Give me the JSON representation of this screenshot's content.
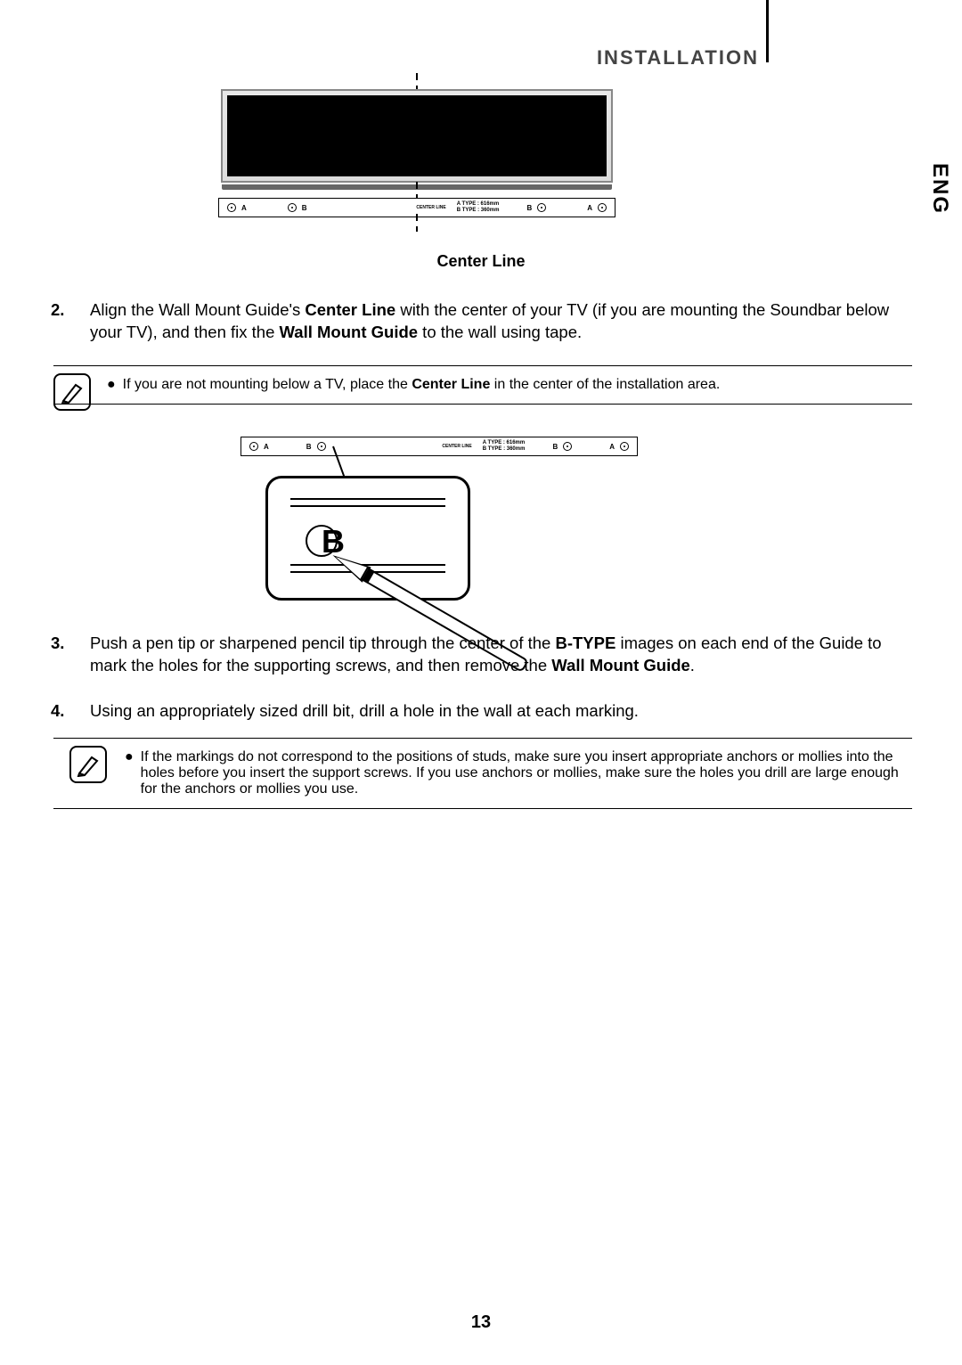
{
  "header": {
    "section_title": "INSTALLATION",
    "lang_tab": "ENG"
  },
  "fig1": {
    "label_A": "A",
    "label_B": "B",
    "label_center": "CENTER LINE",
    "type_a": "A TYPE : 616mm",
    "type_b": "B TYPE : 360mm",
    "caption": "Center Line"
  },
  "steps": {
    "s2_num": "2.",
    "s2_a": "Align the Wall Mount Guide's ",
    "s2_b": "Center Line",
    "s2_c": " with the center of your TV (if you are mounting the Soundbar below your TV), and then fix the ",
    "s2_d": "Wall Mount Guide",
    "s2_e": " to the wall using tape.",
    "s3_num": "3.",
    "s3_a": "Push a pen tip or sharpened pencil tip through the center of the ",
    "s3_b": "B-TYPE",
    "s3_c": " images on each end of the Guide to mark the holes for the supporting screws, and then remove the ",
    "s3_d": "Wall Mount Guide",
    "s3_e": ".",
    "s4_num": "4.",
    "s4_a": "Using an appropriately sized drill bit, drill a hole in the wall at each marking."
  },
  "notes": {
    "n1_a": "If you are not mounting below a TV, place the ",
    "n1_b": "Center Line",
    "n1_c": " in the center of the installation area.",
    "n2": "If the markings do not correspond to the positions of studs, make sure you insert appropriate anchors or mollies into the holes before you insert the support screws. If you use anchors or mollies, make sure the holes you drill are large enough for the anchors or mollies you use."
  },
  "fig2": {
    "bubble_letter": "B"
  },
  "footer": {
    "page_number": "13"
  }
}
